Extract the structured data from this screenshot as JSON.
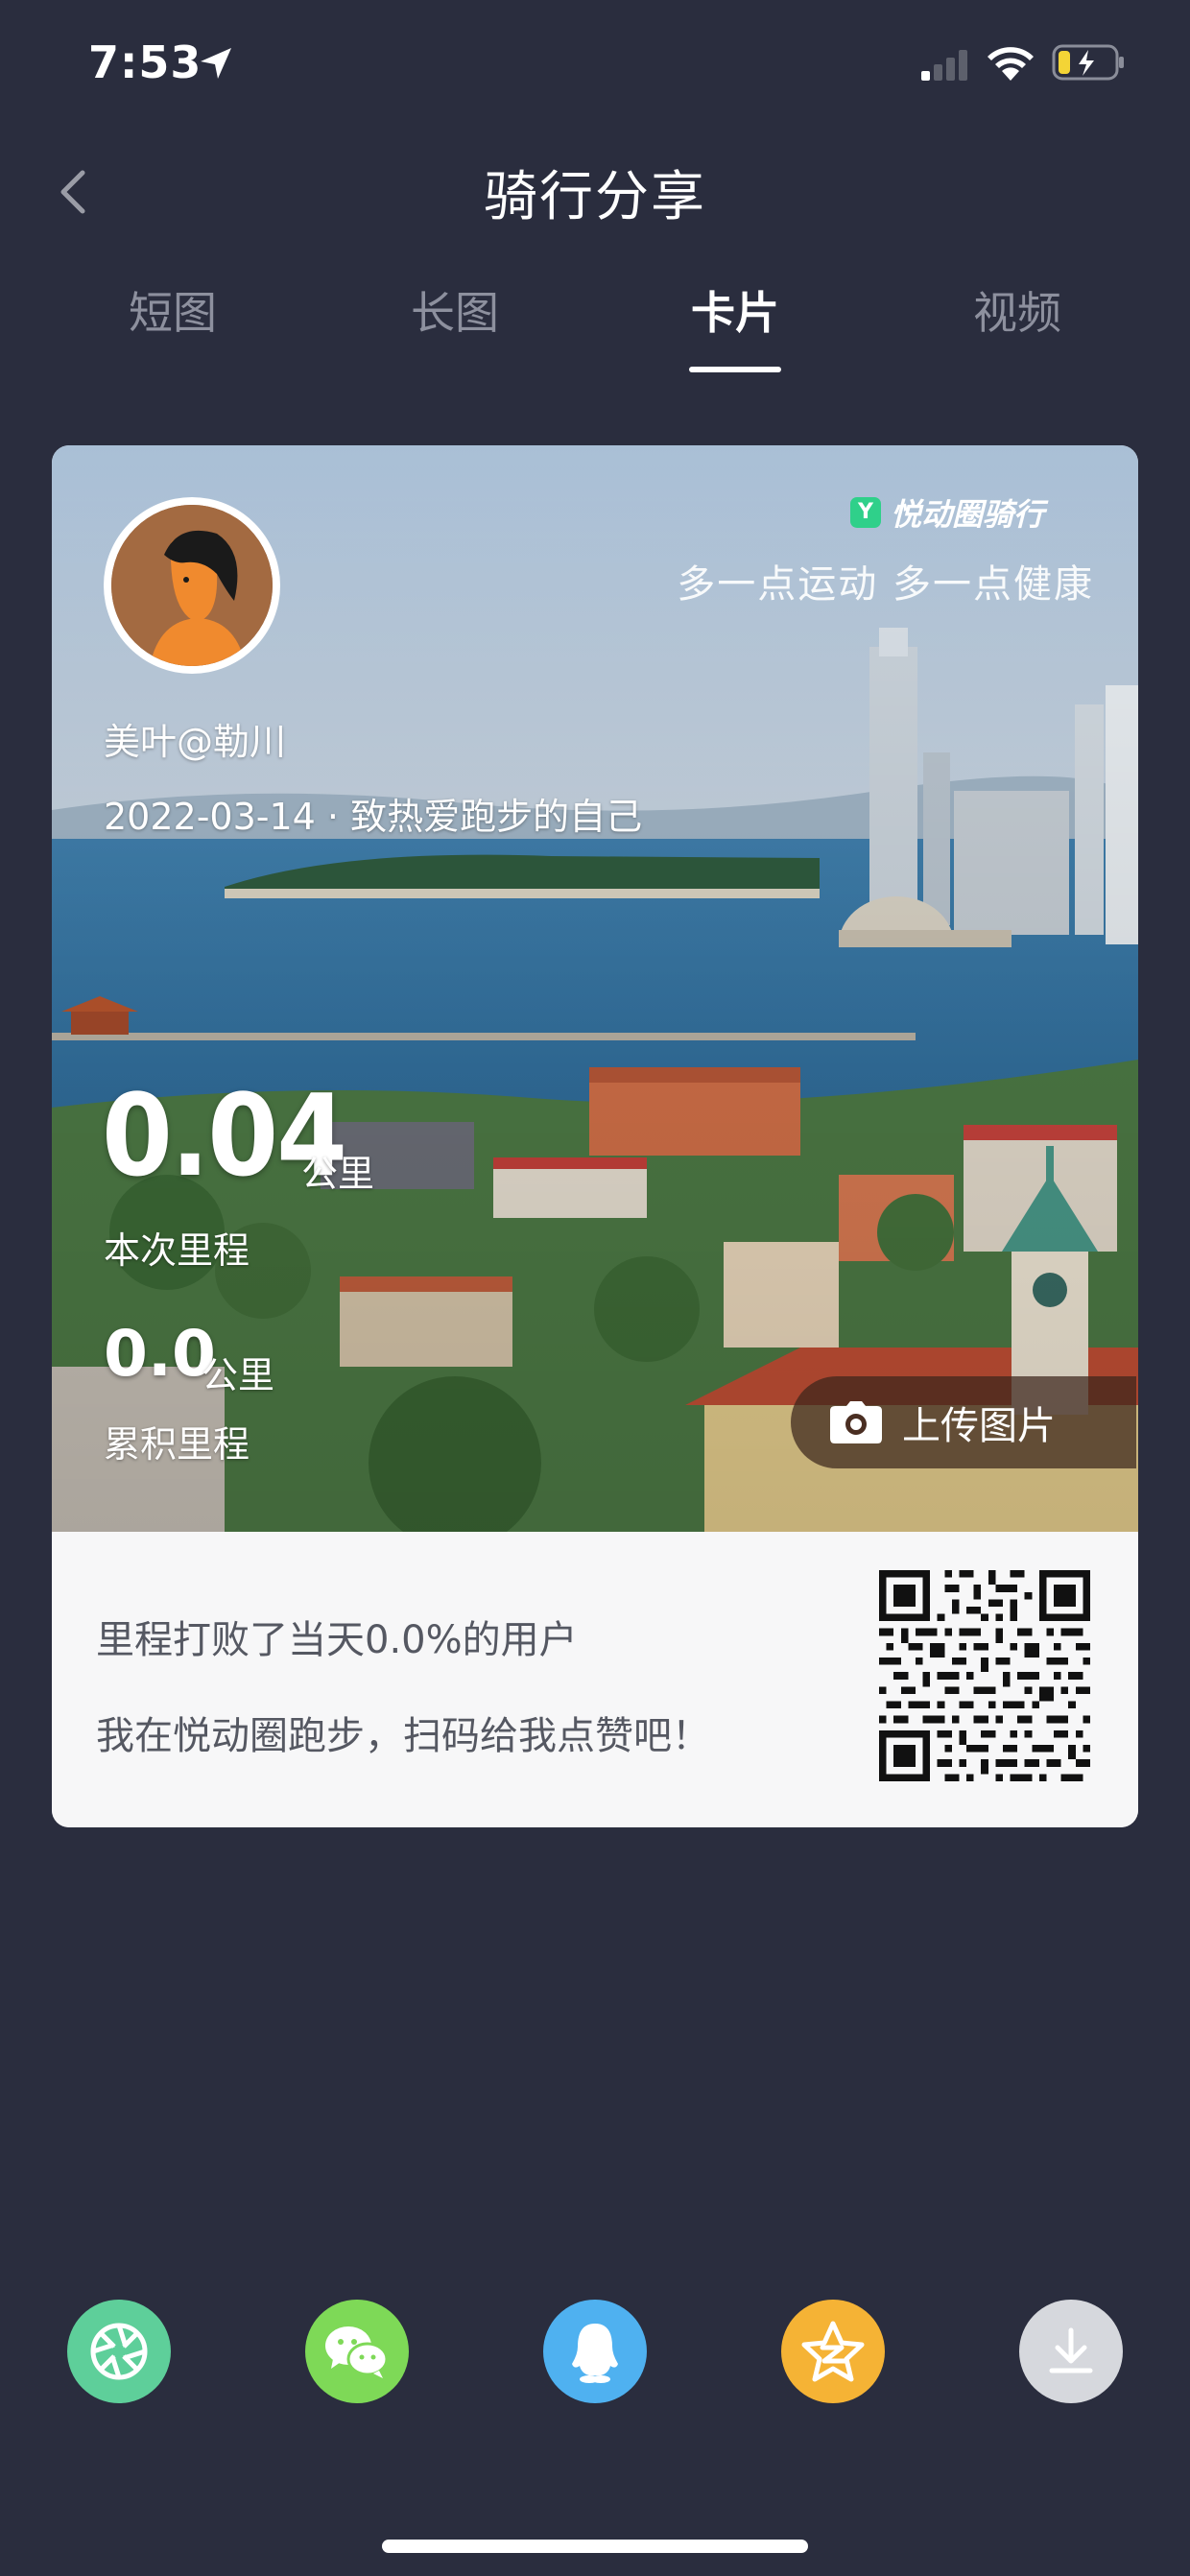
{
  "status_bar": {
    "time": "7:53"
  },
  "nav": {
    "title": "骑行分享"
  },
  "tabs": [
    {
      "label": "短图",
      "active": false
    },
    {
      "label": "长图",
      "active": false
    },
    {
      "label": "卡片",
      "active": true
    },
    {
      "label": "视频",
      "active": false
    }
  ],
  "card": {
    "brand": "悦动圈骑行",
    "brand_logo_letter": "Y",
    "slogan": "多一点运动 多一点健康",
    "username": "美叶@勒川",
    "date_line": "2022-03-14 · 致热爱跑步的自己",
    "distance": {
      "value": "0.04",
      "unit": "公里",
      "label": "本次里程"
    },
    "total": {
      "value": "0.0",
      "unit": "公里",
      "label": "累积里程"
    },
    "upload_label": "上传图片",
    "footer": {
      "beat_text": "里程打败了当天0.0%的用户",
      "invite_text": "我在悦动圈跑步，扫码给我点赞吧！"
    }
  },
  "share_buttons": [
    {
      "icon": "moments-icon",
      "color": "#5ecf9a"
    },
    {
      "icon": "wechat-icon",
      "color": "#7ed957"
    },
    {
      "icon": "qq-icon",
      "color": "#4fb1f0"
    },
    {
      "icon": "qzone-icon",
      "color": "#f5b335"
    },
    {
      "icon": "download-icon",
      "color": "#d6d8dd"
    }
  ]
}
